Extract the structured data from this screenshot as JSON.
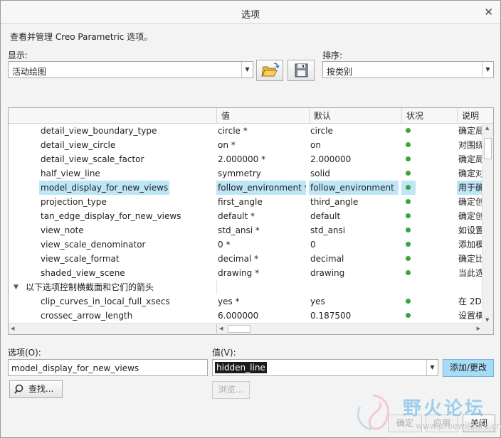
{
  "window": {
    "title": "选项"
  },
  "intro": "查看并管理 Creo Parametric 选项。",
  "display": {
    "label": "显示:",
    "value": "活动绘图"
  },
  "sort": {
    "label": "排序:",
    "value": "按类别"
  },
  "icons": {
    "open": "folder-open-icon",
    "save": "floppy-save-icon"
  },
  "table": {
    "headers": {
      "option": "",
      "value": "值",
      "default": "默认",
      "status": "状况",
      "description": "说明"
    },
    "rows": [
      {
        "name": "detail_view_boundary_type",
        "value": "circle *",
        "default": "circle",
        "desc": "确定局"
      },
      {
        "name": "detail_view_circle",
        "value": "on *",
        "default": "on",
        "desc": "对围绕"
      },
      {
        "name": "detail_view_scale_factor",
        "value": "2.000000 *",
        "default": "2.000000",
        "desc": "确定局"
      },
      {
        "name": "half_view_line",
        "value": "symmetry",
        "default": "solid",
        "desc": "确定对"
      },
      {
        "name": "model_display_for_new_views",
        "value": "follow_environment *",
        "default": "follow_environment",
        "desc": "用于确"
      },
      {
        "name": "projection_type",
        "value": "first_angle",
        "default": "third_angle",
        "desc": "确定创"
      },
      {
        "name": "tan_edge_display_for_new_views",
        "value": "default *",
        "default": "default",
        "desc": "确定创"
      },
      {
        "name": "view_note",
        "value": "std_ansi *",
        "default": "std_ansi",
        "desc": "如设置"
      },
      {
        "name": "view_scale_denominator",
        "value": "0 *",
        "default": "0",
        "desc": "添加模"
      },
      {
        "name": "view_scale_format",
        "value": "decimal *",
        "default": "decimal",
        "desc": "确定比"
      },
      {
        "name": "shaded_view_scene",
        "value": "drawing *",
        "default": "drawing",
        "desc": "当此选"
      },
      {
        "group": "以下选项控制横截面和它们的箭头"
      },
      {
        "name": "clip_curves_in_local_full_xsecs",
        "value": "yes *",
        "default": "yes",
        "desc": "在 2D"
      },
      {
        "name": "crossec_arrow_length",
        "value": "6.000000",
        "default": "0.187500",
        "desc": "设置横"
      }
    ],
    "selected_index": 4,
    "status_color": "#3aa33a",
    "selection_color": "#bfe6f7"
  },
  "option_field": {
    "label": "选项(O):",
    "value": "model_display_for_new_views"
  },
  "value_field": {
    "label": "值(V):",
    "value": "hidden_line"
  },
  "buttons": {
    "find": "查找...",
    "browse": "浏览...",
    "add_change": "添加/更改",
    "ok": "确定",
    "apply": "应用",
    "close": "关闭"
  },
  "watermark": {
    "text": "野火论坛",
    "url": "www.proewildfire.cn"
  }
}
